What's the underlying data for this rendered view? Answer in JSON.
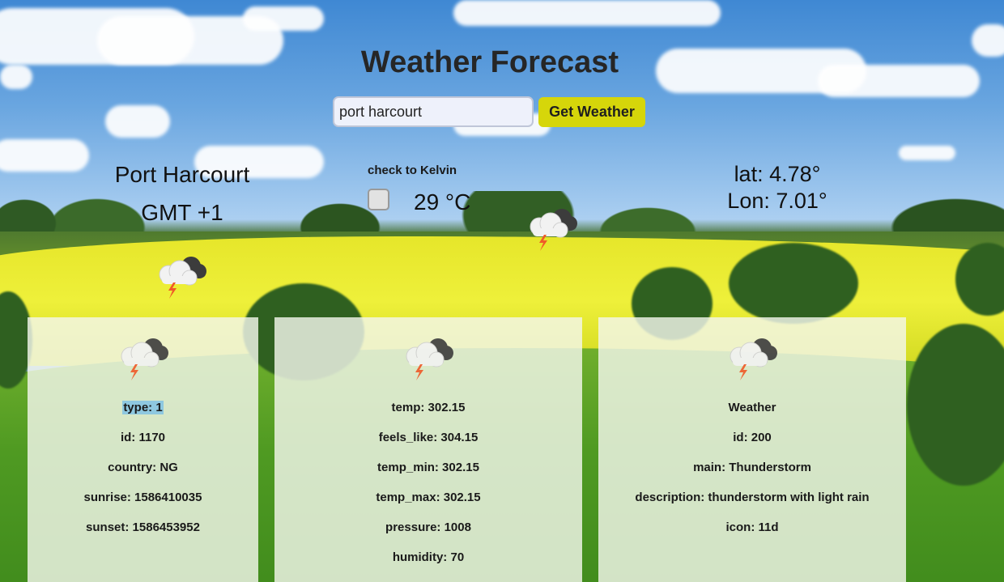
{
  "page": {
    "title": "Weather Forecast"
  },
  "search": {
    "value": "port harcourt",
    "button_label": "Get Weather"
  },
  "location": {
    "city": "Port Harcourt",
    "timezone": "GMT +1",
    "lat": "lat: 4.78°",
    "lon": "Lon: 7.01°"
  },
  "units": {
    "toggle_label": "check to Kelvin",
    "checked": false,
    "temperature": "29 °C"
  },
  "icons": {
    "weather": "thunderstorm-icon"
  },
  "cards": {
    "sys": {
      "items": [
        "type: 1",
        "id: 1170",
        "country: NG",
        "sunrise: 1586410035",
        "sunset: 1586453952"
      ]
    },
    "main": {
      "items": [
        "temp: 302.15",
        "feels_like: 304.15",
        "temp_min: 302.15",
        "temp_max: 302.15",
        "pressure: 1008",
        "humidity: 70"
      ]
    },
    "weather": {
      "items": [
        "Weather",
        "id: 200",
        "main: Thunderstorm",
        "description: thunderstorm with light rain",
        "icon: 11d"
      ]
    }
  },
  "colors": {
    "button": "#d6d60a",
    "highlight": "#8ec8e0"
  }
}
